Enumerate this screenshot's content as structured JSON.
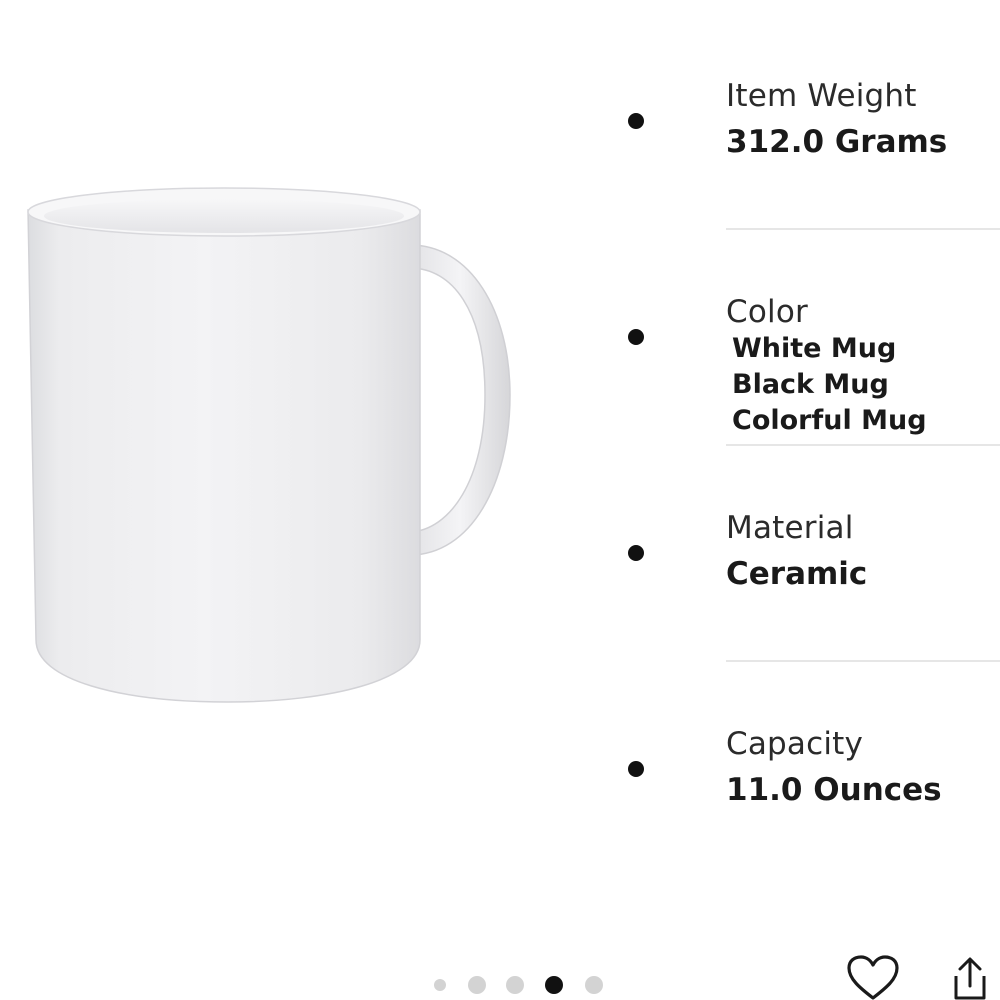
{
  "specs": [
    {
      "label": "Item Weight",
      "value": "312.0 Grams"
    },
    {
      "label": "Color",
      "values": [
        "White Mug",
        "Black Mug",
        "Colorful Mug"
      ]
    },
    {
      "label": "Material",
      "value": "Ceramic"
    },
    {
      "label": "Capacity",
      "value": "11.0 Ounces"
    }
  ],
  "carousel": {
    "total": 5,
    "active_index": 3
  },
  "icons": {
    "favorite": "heart-icon",
    "share": "share-icon"
  },
  "colors": {
    "background": "#ffffff",
    "bullet": "#111111",
    "active_dot": "#111111",
    "inactive_dot": "#d3d3d3",
    "divider": "#e6e6e6"
  }
}
